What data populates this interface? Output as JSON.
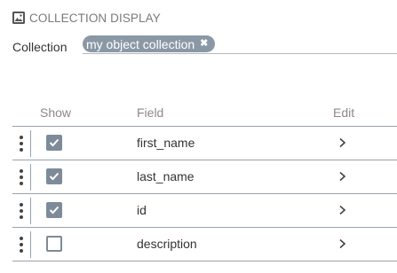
{
  "section": {
    "title": "COLLECTION DISPLAY",
    "icon": "image-icon"
  },
  "collection": {
    "label": "Collection",
    "chip_label": "my object collection",
    "chip_close": "✖"
  },
  "table": {
    "headers": {
      "show": "Show",
      "field": "Field",
      "edit": "Edit"
    },
    "rows": [
      {
        "field": "first_name",
        "show": true
      },
      {
        "field": "last_name",
        "show": true
      },
      {
        "field": "id",
        "show": true
      },
      {
        "field": "description",
        "show": false
      }
    ]
  },
  "colors": {
    "chip_bg": "#8a98a6",
    "checkbox_checked": "#7d8b99",
    "divider": "#9aa3ab"
  }
}
